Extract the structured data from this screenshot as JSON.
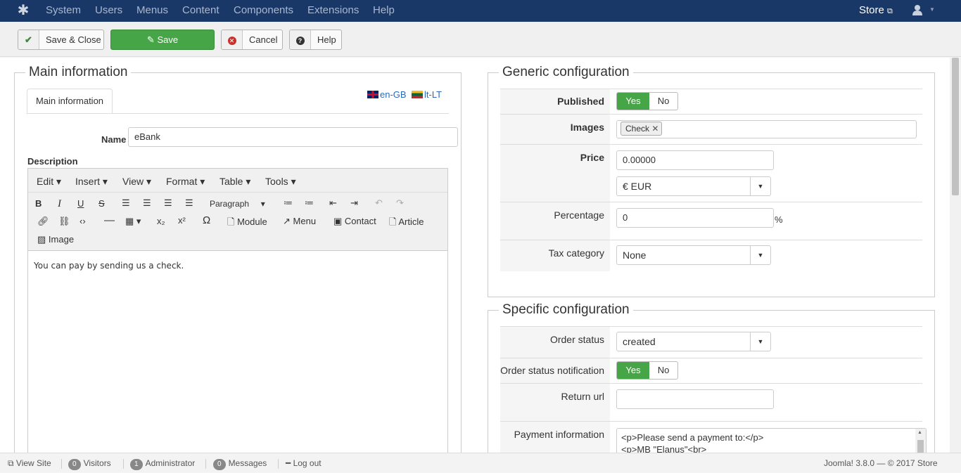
{
  "nav": {
    "items": [
      "System",
      "Users",
      "Menus",
      "Content",
      "Components",
      "Extensions",
      "Help"
    ],
    "store_label": "Store"
  },
  "toolbar": {
    "save_close": "Save & Close",
    "save": "Save",
    "cancel": "Cancel",
    "help": "Help"
  },
  "main_info": {
    "legend": "Main information",
    "tab_label": "Main information",
    "lang_en": "en-GB",
    "lang_lt": "lt-LT",
    "name_label": "Name",
    "name_value": "eBank",
    "description_label": "Description"
  },
  "editor": {
    "menus": [
      "Edit",
      "Insert",
      "View",
      "Format",
      "Table",
      "Tools"
    ],
    "paragraph": "Paragraph",
    "module_label": "Module",
    "menu_label": "Menu",
    "contact_label": "Contact",
    "article_label": "Article",
    "image_label": "Image",
    "content": "You can pay by sending us a check."
  },
  "generic": {
    "legend": "Generic configuration",
    "published_label": "Published",
    "yes": "Yes",
    "no": "No",
    "published": "yes",
    "images_label": "Images",
    "image_chip": "Check",
    "price_label": "Price",
    "price_value": "0.00000",
    "currency": "€ EUR",
    "percentage_label": "Percentage",
    "percentage_value": "0",
    "percent_sign": "%",
    "tax_label": "Tax category",
    "tax_value": "None"
  },
  "specific": {
    "legend": "Specific configuration",
    "order_status_label": "Order status",
    "order_status_value": "created",
    "notification_label": "Order status notification",
    "notification": "yes",
    "return_url_label": "Return url",
    "return_url_value": "",
    "payment_info_label": "Payment information",
    "payment_info_line1": "<p>Please send a payment to:</p>",
    "payment_info_line2": "<p>MB \"Elanus\"<br>"
  },
  "footer": {
    "view_site": "View Site",
    "visitors_count": "0",
    "visitors_label": "Visitors",
    "admin_count": "1",
    "admin_label": "Administrator",
    "messages_count": "0",
    "messages_label": "Messages",
    "logout": "Log out",
    "version": "Joomla! 3.8.0  —  © 2017 Store"
  },
  "colors": {
    "navbar": "#1a3867",
    "success": "#46a546"
  }
}
